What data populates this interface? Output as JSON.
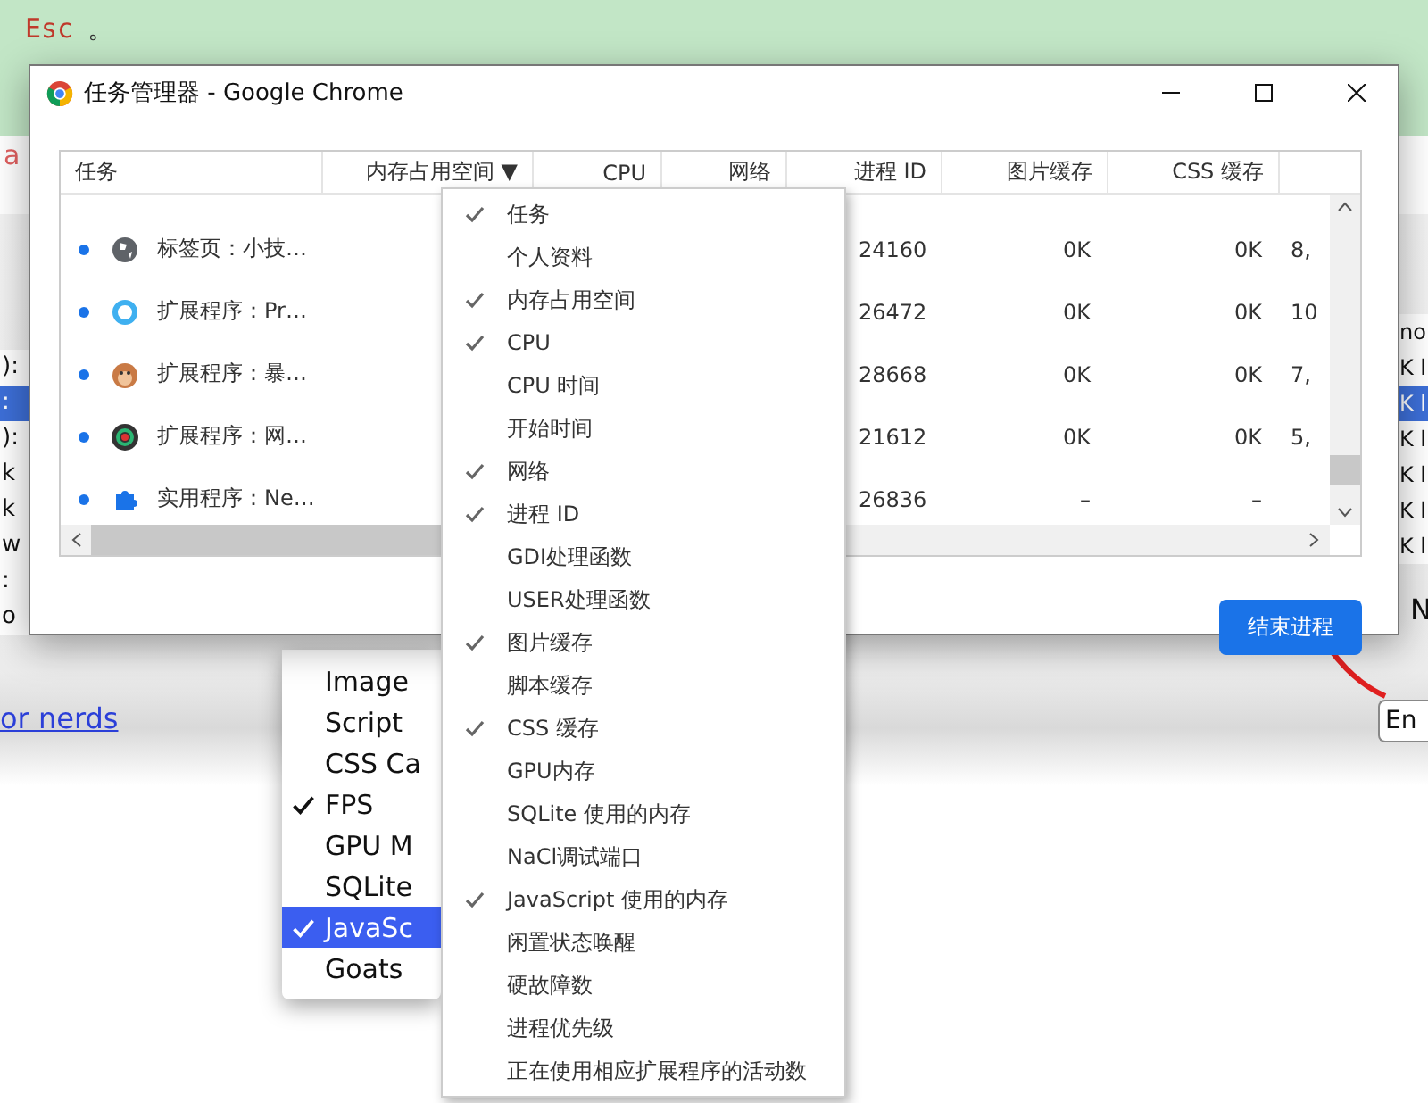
{
  "page": {
    "code_text": "Esc",
    "punctuation": "。",
    "partial_text": "a",
    "link": "or nerds"
  },
  "background_screenshot": {
    "left_rows": [
      {
        "text": "):",
        "selected": false
      },
      {
        "text": ":",
        "selected": true
      },
      {
        "text": "):",
        "selected": false
      },
      {
        "text": "k",
        "selected": false
      },
      {
        "text": "k",
        "selected": false
      },
      {
        "text": "w",
        "selected": false
      },
      {
        "text": ":",
        "selected": false
      },
      {
        "text": "o",
        "selected": false
      }
    ],
    "right_rows": [
      {
        "text": "no",
        "selected": false
      },
      {
        "text": "K l",
        "selected": false
      },
      {
        "text": "K l",
        "selected": true
      },
      {
        "text": "K l",
        "selected": false
      },
      {
        "text": "K l",
        "selected": false
      },
      {
        "text": "K l",
        "selected": false
      },
      {
        "text": "K l",
        "selected": false
      }
    ],
    "right_letter": "N",
    "end_button": "En",
    "menu_items": [
      {
        "label": "Image",
        "checked": false,
        "selected": false
      },
      {
        "label": "Script",
        "checked": false,
        "selected": false
      },
      {
        "label": "CSS Ca",
        "checked": false,
        "selected": false
      },
      {
        "label": "FPS",
        "checked": true,
        "selected": false
      },
      {
        "label": "GPU M",
        "checked": false,
        "selected": false
      },
      {
        "label": "SQLite",
        "checked": false,
        "selected": false
      },
      {
        "label": "JavaSc",
        "checked": true,
        "selected": true
      },
      {
        "label": "Goats",
        "checked": false,
        "selected": false
      }
    ]
  },
  "window": {
    "title": "任务管理器 - Google Chrome",
    "columns": [
      {
        "label": "任务"
      },
      {
        "label": "内存占用空间",
        "sort_indicator": "▼"
      },
      {
        "label": "CPU"
      },
      {
        "label": "网络"
      },
      {
        "label": "进程 ID"
      },
      {
        "label": "图片缓存"
      },
      {
        "label": "CSS 缓存"
      }
    ],
    "rows": [
      {
        "kind": "globe",
        "name": "标签页：小技…",
        "cells": [
          "24160",
          "0K",
          "0K",
          "8,"
        ]
      },
      {
        "kind": "ring",
        "name": "扩展程序：Pr…",
        "cells": [
          "26472",
          "0K",
          "0K",
          "10"
        ]
      },
      {
        "kind": "monkey",
        "name": "扩展程序：暴…",
        "cells": [
          "28668",
          "0K",
          "0K",
          "7,"
        ]
      },
      {
        "kind": "lens",
        "name": "扩展程序：网…",
        "cells": [
          "21612",
          "0K",
          "0K",
          "5,"
        ]
      },
      {
        "kind": "puzzle",
        "name": "实用程序：Ne…",
        "cells": [
          "26836",
          "–",
          "–"
        ]
      }
    ],
    "end_button": "结束进程"
  },
  "column_menu": [
    {
      "label": "任务",
      "checked": true
    },
    {
      "label": "个人资料",
      "checked": false
    },
    {
      "label": "内存占用空间",
      "checked": true
    },
    {
      "label": "CPU",
      "checked": true
    },
    {
      "label": "CPU 时间",
      "checked": false
    },
    {
      "label": "开始时间",
      "checked": false
    },
    {
      "label": "网络",
      "checked": true
    },
    {
      "label": "进程 ID",
      "checked": true
    },
    {
      "label": "GDI处理函数",
      "checked": false
    },
    {
      "label": "USER处理函数",
      "checked": false
    },
    {
      "label": "图片缓存",
      "checked": true
    },
    {
      "label": "脚本缓存",
      "checked": false
    },
    {
      "label": "CSS 缓存",
      "checked": true
    },
    {
      "label": "GPU内存",
      "checked": false
    },
    {
      "label": "SQLite 使用的内存",
      "checked": false
    },
    {
      "label": "NaCl调试端口",
      "checked": false
    },
    {
      "label": "JavaScript 使用的内存",
      "checked": true
    },
    {
      "label": "闲置状态唤醒",
      "checked": false
    },
    {
      "label": "硬故障数",
      "checked": false
    },
    {
      "label": "进程优先级",
      "checked": false
    },
    {
      "label": "正在使用相应扩展程序的活动数",
      "checked": false
    }
  ]
}
